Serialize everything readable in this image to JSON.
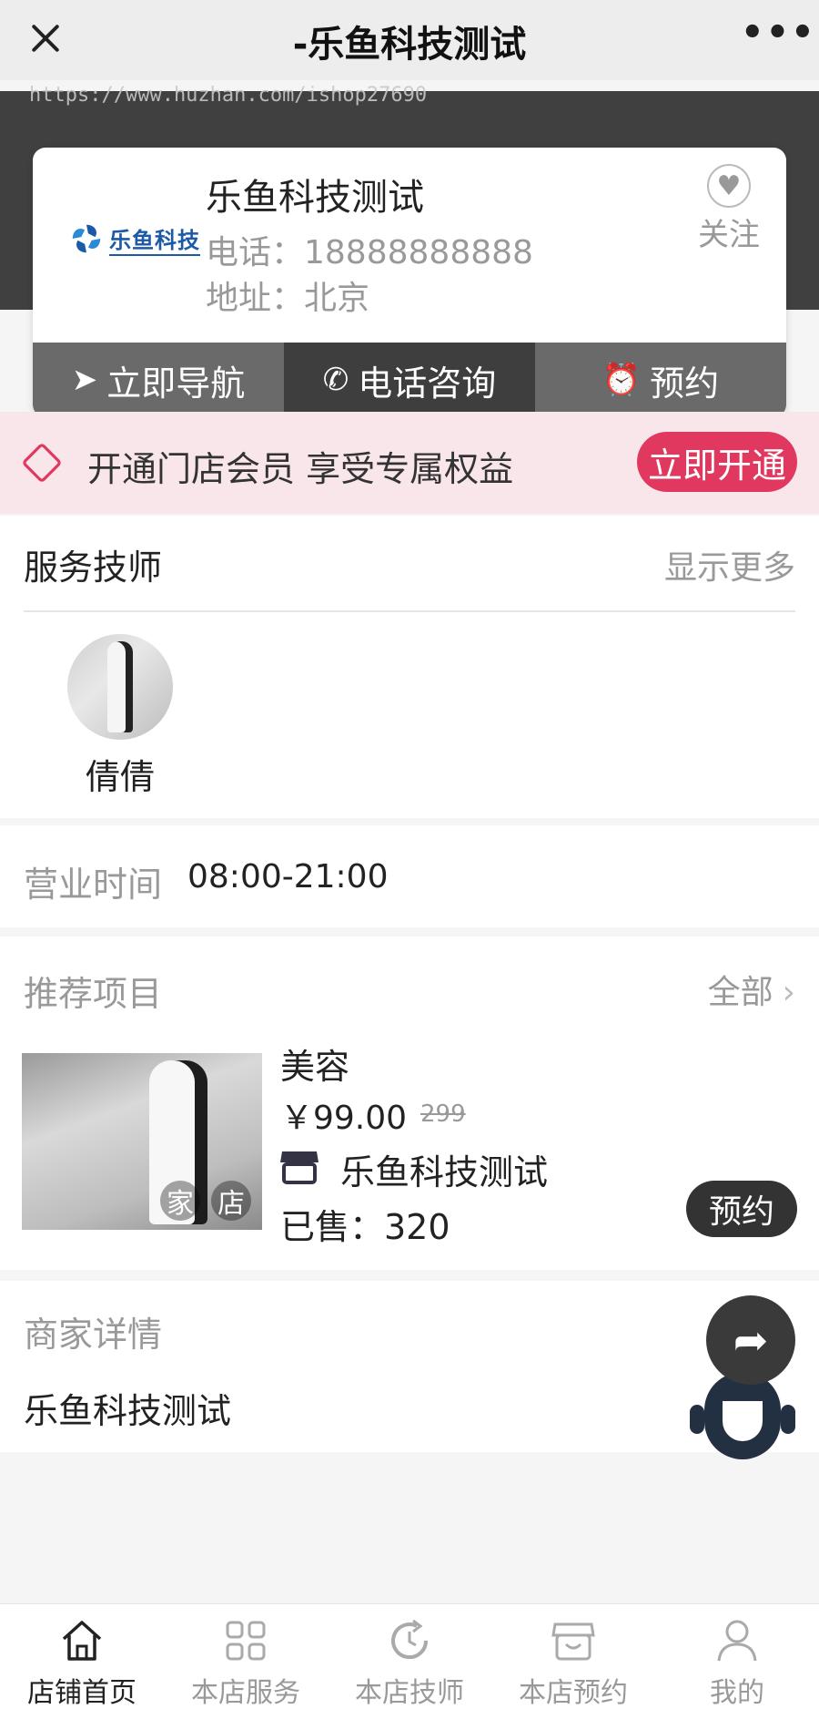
{
  "topbar": {
    "title": "-乐鱼科技测试",
    "close_icon": "close-icon",
    "more_icon": "more-dots-icon",
    "more_label": "•••"
  },
  "watermark": "https://www.huzhan.com/ishop27690",
  "store": {
    "logo_text": "乐鱼科技",
    "name": "乐鱼科技测试",
    "phone": "电话：18888888888",
    "address": "地址：北京",
    "follow_label": "关注",
    "follow_icon": "heart-icon",
    "heart_glyph": "♥",
    "actions": [
      {
        "label": "立即导航",
        "icon": "navigation-arrow-icon",
        "glyph": "➤"
      },
      {
        "label": "电话咨询",
        "icon": "phone-icon",
        "glyph": "✆"
      },
      {
        "label": "预约",
        "icon": "alarm-clock-icon",
        "glyph": "⏰"
      }
    ]
  },
  "member": {
    "text": "开通门店会员 享受专属权益",
    "button": "立即开通",
    "icon": "diamond-icon"
  },
  "technicians": {
    "title": "服务技师",
    "more": "显示更多",
    "items": [
      {
        "name": "倩倩"
      }
    ]
  },
  "hours": {
    "label": "营业时间",
    "value": "08:00-21:00"
  },
  "recommended": {
    "title": "推荐项目",
    "all_label": "全部",
    "arrow": "›",
    "item": {
      "name": "美容",
      "price": "￥99.00",
      "old_price": "299",
      "shop": "乐鱼科技测试",
      "sold": "已售：320",
      "book": "预约",
      "tags": [
        "家",
        "店"
      ]
    }
  },
  "detail": {
    "label": "商家详情",
    "value": "乐鱼科技测试"
  },
  "floating": {
    "share_glyph": "➦",
    "share_icon": "share-icon",
    "service_icon": "customer-service-icon"
  },
  "tabbar": {
    "items": [
      {
        "label": "店铺首页",
        "icon": "home-icon",
        "active": true
      },
      {
        "label": "本店服务",
        "icon": "grid-icon",
        "active": false
      },
      {
        "label": "本店技师",
        "icon": "refresh-clock-icon",
        "active": false
      },
      {
        "label": "本店预约",
        "icon": "store-icon",
        "active": false
      },
      {
        "label": "我的",
        "icon": "user-icon",
        "active": false
      }
    ]
  },
  "colors": {
    "accent": "#e0385f",
    "dark": "#3e3e3e",
    "muted": "#999999",
    "banner_bg": "#f8e6ea"
  }
}
